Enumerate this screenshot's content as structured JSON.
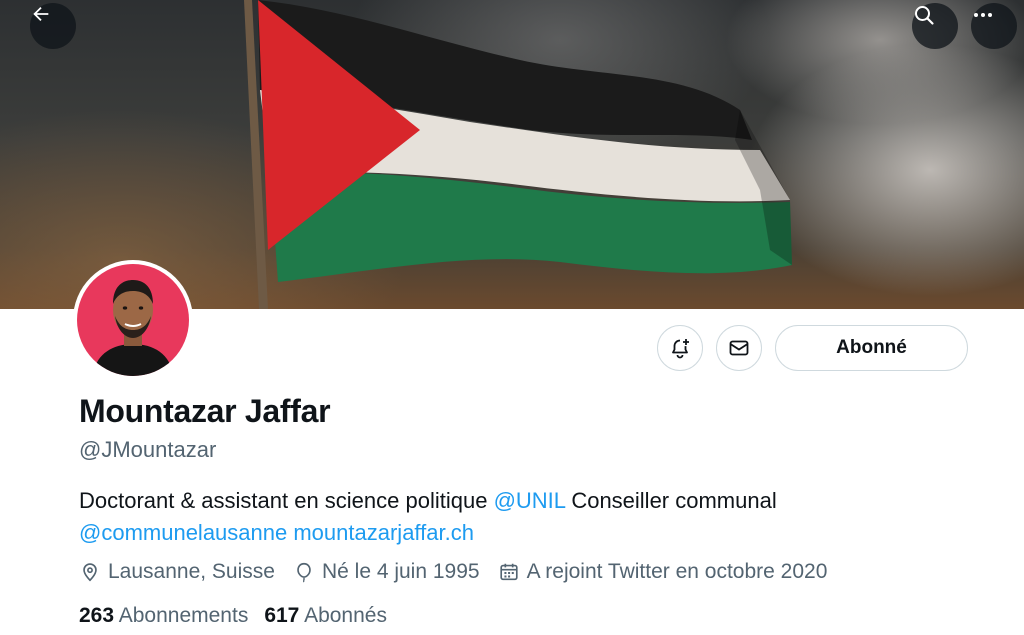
{
  "header": {
    "back_icon": "arrow-left-icon",
    "search_icon": "search-icon",
    "more_icon": "more-horizontal-icon"
  },
  "profile": {
    "name": "Mountazar Jaffar",
    "handle": "@JMountazar",
    "bio_text_1": "Doctorant & assistant en science politique ",
    "bio_mention_1": "@UNIL",
    "bio_text_2": " Conseiller communal",
    "bio_mention_2": "@communelausanne",
    "bio_website": "mountazarjaffar.ch",
    "location": "Lausanne, Suisse",
    "birth": "Né le 4 juin 1995",
    "joined": "A rejoint Twitter en octobre 2020"
  },
  "actions": {
    "notify_icon": "bell-plus-icon",
    "message_icon": "envelope-icon",
    "follow_label": "Abonné"
  },
  "stats": {
    "following_count": "263",
    "following_label": "Abonnements",
    "followers_count": "617",
    "followers_label": "Abonnés"
  },
  "colors": {
    "link": "#1d9bf0",
    "secondary_text": "#536471",
    "avatar_bg": "#e8385c",
    "flag_red": "#d8262b",
    "flag_green": "#1f7a4a"
  }
}
